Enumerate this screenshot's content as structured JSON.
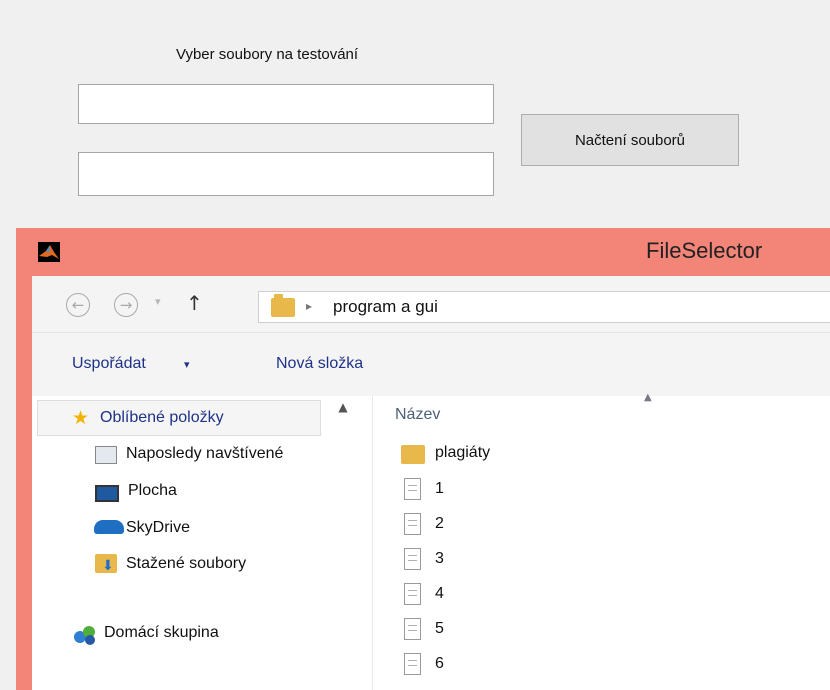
{
  "top_panel": {
    "label": "Vyber soubory na testování",
    "field1_value": "",
    "field2_value": "",
    "load_button": "Načtení souborů"
  },
  "dialog": {
    "title": "FileSelector",
    "nav": {
      "back": "←",
      "forward": "→",
      "recent": "▾",
      "up": "↑",
      "path_separator": "▸",
      "path": "program a gui"
    },
    "toolbar": {
      "organize": "Uspořádat",
      "organize_arrow": "▾",
      "new_folder": "Nová složka"
    },
    "nav_pane": {
      "favorites": "Oblíbené položky",
      "items": [
        "Naposledy navštívené",
        "Plocha",
        "SkyDrive",
        "Stažené soubory"
      ],
      "homegroup": "Domácí skupina"
    },
    "file_pane": {
      "column_header": "Název",
      "files": [
        {
          "name": "plagiáty",
          "type": "folder"
        },
        {
          "name": "1",
          "type": "file"
        },
        {
          "name": "2",
          "type": "file"
        },
        {
          "name": "3",
          "type": "file"
        },
        {
          "name": "4",
          "type": "file"
        },
        {
          "name": "5",
          "type": "file"
        },
        {
          "name": "6",
          "type": "file"
        }
      ]
    }
  },
  "colors": {
    "title_bar": "#f28478",
    "link_blue": "#1e3287",
    "folder": "#e8b84a"
  },
  "icons": [
    "matlab-logo-icon",
    "back-arrow-icon",
    "forward-arrow-icon",
    "up-arrow-icon",
    "folder-icon",
    "star-icon",
    "recent-places-icon",
    "desktop-icon",
    "skydrive-icon",
    "downloads-icon",
    "homegroup-icon",
    "document-icon"
  ]
}
